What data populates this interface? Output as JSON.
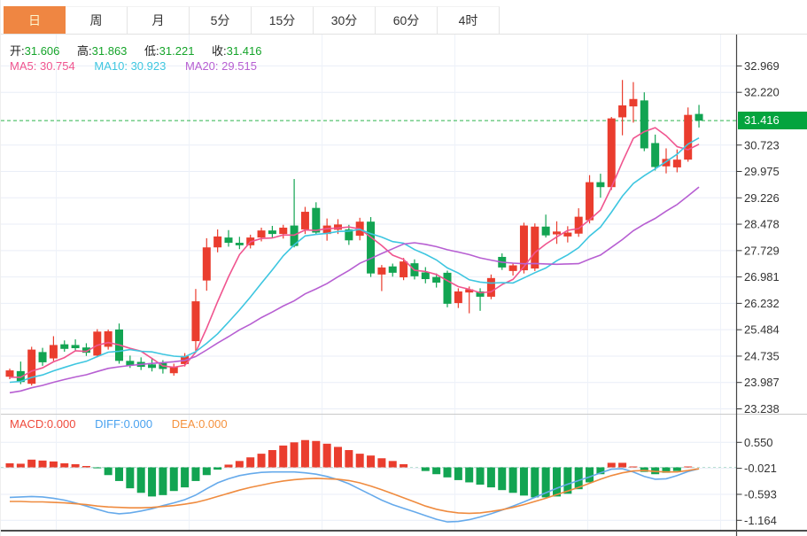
{
  "toolbar": {
    "tabs": [
      {
        "label": "日"
      },
      {
        "label": "周"
      },
      {
        "label": "月"
      },
      {
        "label": "5分"
      },
      {
        "label": "15分"
      },
      {
        "label": "30分"
      },
      {
        "label": "60分"
      },
      {
        "label": "4时"
      }
    ],
    "active_index": 0
  },
  "quote_bar": {
    "open_label": "开:",
    "open_value": "31.606",
    "high_label": "高:",
    "high_value": "31.863",
    "low_label": "低:",
    "low_value": "31.221",
    "close_label": "收:",
    "close_value": "31.416"
  },
  "ma_bar": {
    "ma5_label": "MA5:",
    "ma5_value": "30.754",
    "ma10_label": "MA10:",
    "ma10_value": "30.923",
    "ma20_label": "MA20:",
    "ma20_value": "29.515"
  },
  "macd_bar": {
    "macd_label": "MACD:",
    "macd_value": "0.000",
    "diff_label": "DIFF:",
    "diff_value": "0.000",
    "dea_label": "DEA:",
    "dea_value": "0.000"
  },
  "price_axis": {
    "ticks": [
      "32.969",
      "32.220",
      "30.723",
      "29.975",
      "29.226",
      "28.478",
      "27.729",
      "26.981",
      "26.232",
      "25.484",
      "24.735",
      "23.987",
      "23.238"
    ],
    "current_price": "31.416"
  },
  "macd_axis": {
    "ticks": [
      "0.550",
      "-0.021",
      "-0.593",
      "-1.164"
    ]
  },
  "colors": {
    "up": "#ea3d2e",
    "down": "#12a452",
    "ma5": "#f0558f",
    "ma10": "#3ec6e0",
    "ma20": "#b75fd2",
    "diff_line": "#66aaeb",
    "dea_line": "#ef8b3f",
    "accent_tab": "#ef8642",
    "price_tag_bg": "#04a43e",
    "dashed_price_line": "#2cb34c",
    "grid": "#e9eef7"
  },
  "chart_data": {
    "type": "candlestick",
    "title": "",
    "ohlc_format": [
      "open",
      "high",
      "low",
      "close"
    ],
    "ohlc": [
      [
        24.15,
        24.38,
        24.08,
        24.33
      ],
      [
        24.31,
        24.58,
        23.94,
        24.0
      ],
      [
        23.95,
        25.0,
        23.9,
        24.92
      ],
      [
        24.85,
        24.97,
        24.46,
        24.56
      ],
      [
        24.67,
        25.3,
        24.6,
        25.05
      ],
      [
        25.07,
        25.18,
        24.86,
        24.94
      ],
      [
        25.05,
        25.21,
        24.88,
        24.96
      ],
      [
        24.98,
        25.1,
        24.74,
        24.83
      ],
      [
        24.75,
        25.5,
        24.7,
        25.43
      ],
      [
        25.0,
        25.49,
        24.92,
        25.44
      ],
      [
        25.49,
        25.66,
        24.52,
        24.6
      ],
      [
        24.6,
        24.75,
        24.4,
        24.47
      ],
      [
        24.57,
        24.7,
        24.34,
        24.43
      ],
      [
        24.5,
        24.68,
        24.3,
        24.4
      ],
      [
        24.54,
        24.62,
        24.24,
        24.37
      ],
      [
        24.25,
        24.52,
        24.18,
        24.42
      ],
      [
        24.51,
        24.82,
        24.44,
        24.74
      ],
      [
        25.16,
        26.64,
        24.88,
        26.29
      ],
      [
        26.88,
        28.08,
        26.59,
        27.82
      ],
      [
        27.82,
        28.33,
        27.68,
        28.13
      ],
      [
        28.1,
        28.31,
        27.84,
        27.95
      ],
      [
        27.95,
        28.12,
        27.77,
        27.88
      ],
      [
        27.88,
        28.18,
        27.79,
        28.1
      ],
      [
        28.1,
        28.38,
        27.99,
        28.3
      ],
      [
        28.3,
        28.43,
        28.09,
        28.2
      ],
      [
        28.2,
        28.46,
        28.07,
        28.38
      ],
      [
        28.44,
        29.76,
        27.82,
        27.86
      ],
      [
        28.33,
        28.97,
        28.2,
        28.83
      ],
      [
        28.94,
        29.1,
        28.18,
        28.24
      ],
      [
        28.2,
        28.64,
        28.01,
        28.44
      ],
      [
        28.32,
        28.62,
        28.2,
        28.47
      ],
      [
        28.33,
        28.46,
        27.89,
        28.02
      ],
      [
        28.15,
        28.66,
        28.02,
        28.55
      ],
      [
        28.55,
        28.68,
        26.98,
        27.08
      ],
      [
        27.05,
        27.32,
        26.58,
        27.25
      ],
      [
        27.28,
        27.36,
        26.99,
        27.1
      ],
      [
        26.97,
        27.52,
        26.89,
        27.42
      ],
      [
        27.37,
        27.48,
        26.91,
        27.0
      ],
      [
        27.11,
        27.26,
        26.8,
        26.92
      ],
      [
        26.98,
        27.08,
        26.68,
        26.82
      ],
      [
        27.1,
        27.16,
        26.12,
        26.22
      ],
      [
        26.24,
        26.66,
        26.1,
        26.57
      ],
      [
        26.54,
        26.71,
        25.95,
        26.63
      ],
      [
        26.57,
        26.66,
        26.02,
        26.42
      ],
      [
        26.42,
        27.05,
        26.35,
        26.95
      ],
      [
        27.55,
        27.65,
        27.18,
        27.25
      ],
      [
        27.15,
        27.36,
        27.02,
        27.31
      ],
      [
        27.17,
        28.52,
        27.08,
        28.44
      ],
      [
        27.22,
        28.5,
        27.15,
        28.41
      ],
      [
        28.41,
        28.75,
        28.1,
        28.16
      ],
      [
        28.19,
        28.56,
        27.92,
        28.27
      ],
      [
        28.13,
        28.42,
        27.96,
        28.24
      ],
      [
        28.21,
        28.93,
        28.12,
        28.69
      ],
      [
        28.59,
        29.87,
        28.5,
        29.67
      ],
      [
        29.67,
        29.91,
        29.23,
        29.53
      ],
      [
        29.53,
        31.52,
        29.45,
        31.48
      ],
      [
        31.51,
        32.57,
        31.0,
        31.85
      ],
      [
        31.82,
        32.51,
        31.36,
        32.03
      ],
      [
        31.99,
        32.22,
        30.55,
        30.63
      ],
      [
        30.78,
        31.02,
        30.0,
        30.1
      ],
      [
        30.12,
        30.63,
        29.92,
        30.33
      ],
      [
        30.09,
        30.6,
        29.95,
        30.31
      ],
      [
        30.31,
        31.79,
        30.25,
        31.58
      ],
      [
        31.606,
        31.863,
        31.221,
        31.416
      ]
    ],
    "current_price": 31.416,
    "price_gridlines": [
      32.969,
      32.22,
      30.723,
      29.975,
      29.226,
      28.478,
      27.729,
      26.981,
      26.232,
      25.484,
      24.735,
      23.987,
      23.238
    ],
    "ma": {
      "periods": [
        5,
        10,
        20
      ],
      "seed_prior_closes": [
        23.0,
        23.1,
        23.2,
        23.3,
        23.4,
        23.5,
        23.55,
        23.6,
        23.65,
        23.7,
        23.75,
        23.8,
        23.85,
        23.9,
        23.95,
        24.0,
        24.05,
        24.1,
        24.2
      ]
    },
    "macd": {
      "gridlines": [
        0.55,
        -0.021,
        -0.593,
        -1.164
      ],
      "histogram": [
        0.09,
        0.08,
        0.17,
        0.15,
        0.13,
        0.09,
        0.07,
        0.03,
        -0.02,
        -0.17,
        -0.3,
        -0.46,
        -0.56,
        -0.64,
        -0.61,
        -0.52,
        -0.44,
        -0.3,
        -0.17,
        -0.05,
        0.06,
        0.14,
        0.22,
        0.3,
        0.38,
        0.48,
        0.55,
        0.6,
        0.58,
        0.52,
        0.45,
        0.38,
        0.3,
        0.26,
        0.2,
        0.14,
        0.07,
        0.0,
        -0.08,
        -0.15,
        -0.22,
        -0.28,
        -0.33,
        -0.38,
        -0.44,
        -0.5,
        -0.56,
        -0.62,
        -0.66,
        -0.66,
        -0.64,
        -0.58,
        -0.48,
        -0.33,
        -0.15,
        0.1,
        0.1,
        0.02,
        -0.1,
        -0.15,
        -0.12,
        -0.08,
        0.02,
        0.0
      ],
      "diff": [
        -0.66,
        -0.65,
        -0.64,
        -0.65,
        -0.68,
        -0.72,
        -0.78,
        -0.85,
        -0.92,
        -0.99,
        -1.02,
        -1.0,
        -0.96,
        -0.91,
        -0.84,
        -0.78,
        -0.71,
        -0.61,
        -0.47,
        -0.34,
        -0.25,
        -0.18,
        -0.14,
        -0.11,
        -0.1,
        -0.1,
        -0.1,
        -0.12,
        -0.15,
        -0.2,
        -0.27,
        -0.36,
        -0.48,
        -0.6,
        -0.72,
        -0.82,
        -0.9,
        -0.98,
        -1.06,
        -1.14,
        -1.2,
        -1.19,
        -1.15,
        -1.09,
        -1.02,
        -0.94,
        -0.85,
        -0.76,
        -0.66,
        -0.56,
        -0.46,
        -0.37,
        -0.29,
        -0.21,
        -0.12,
        -0.04,
        -0.03,
        -0.1,
        -0.2,
        -0.26,
        -0.25,
        -0.18,
        -0.09,
        -0.03
      ],
      "dea": [
        -0.75,
        -0.75,
        -0.76,
        -0.76,
        -0.77,
        -0.78,
        -0.8,
        -0.82,
        -0.85,
        -0.87,
        -0.88,
        -0.89,
        -0.89,
        -0.88,
        -0.86,
        -0.84,
        -0.81,
        -0.77,
        -0.71,
        -0.64,
        -0.57,
        -0.5,
        -0.44,
        -0.39,
        -0.34,
        -0.3,
        -0.27,
        -0.25,
        -0.24,
        -0.25,
        -0.26,
        -0.29,
        -0.34,
        -0.41,
        -0.49,
        -0.58,
        -0.67,
        -0.76,
        -0.85,
        -0.92,
        -0.97,
        -1.0,
        -1.01,
        -1.0,
        -0.97,
        -0.93,
        -0.88,
        -0.82,
        -0.75,
        -0.68,
        -0.6,
        -0.52,
        -0.44,
        -0.35,
        -0.26,
        -0.18,
        -0.12,
        -0.08,
        -0.07,
        -0.09,
        -0.1,
        -0.1,
        -0.07,
        -0.03
      ]
    }
  }
}
